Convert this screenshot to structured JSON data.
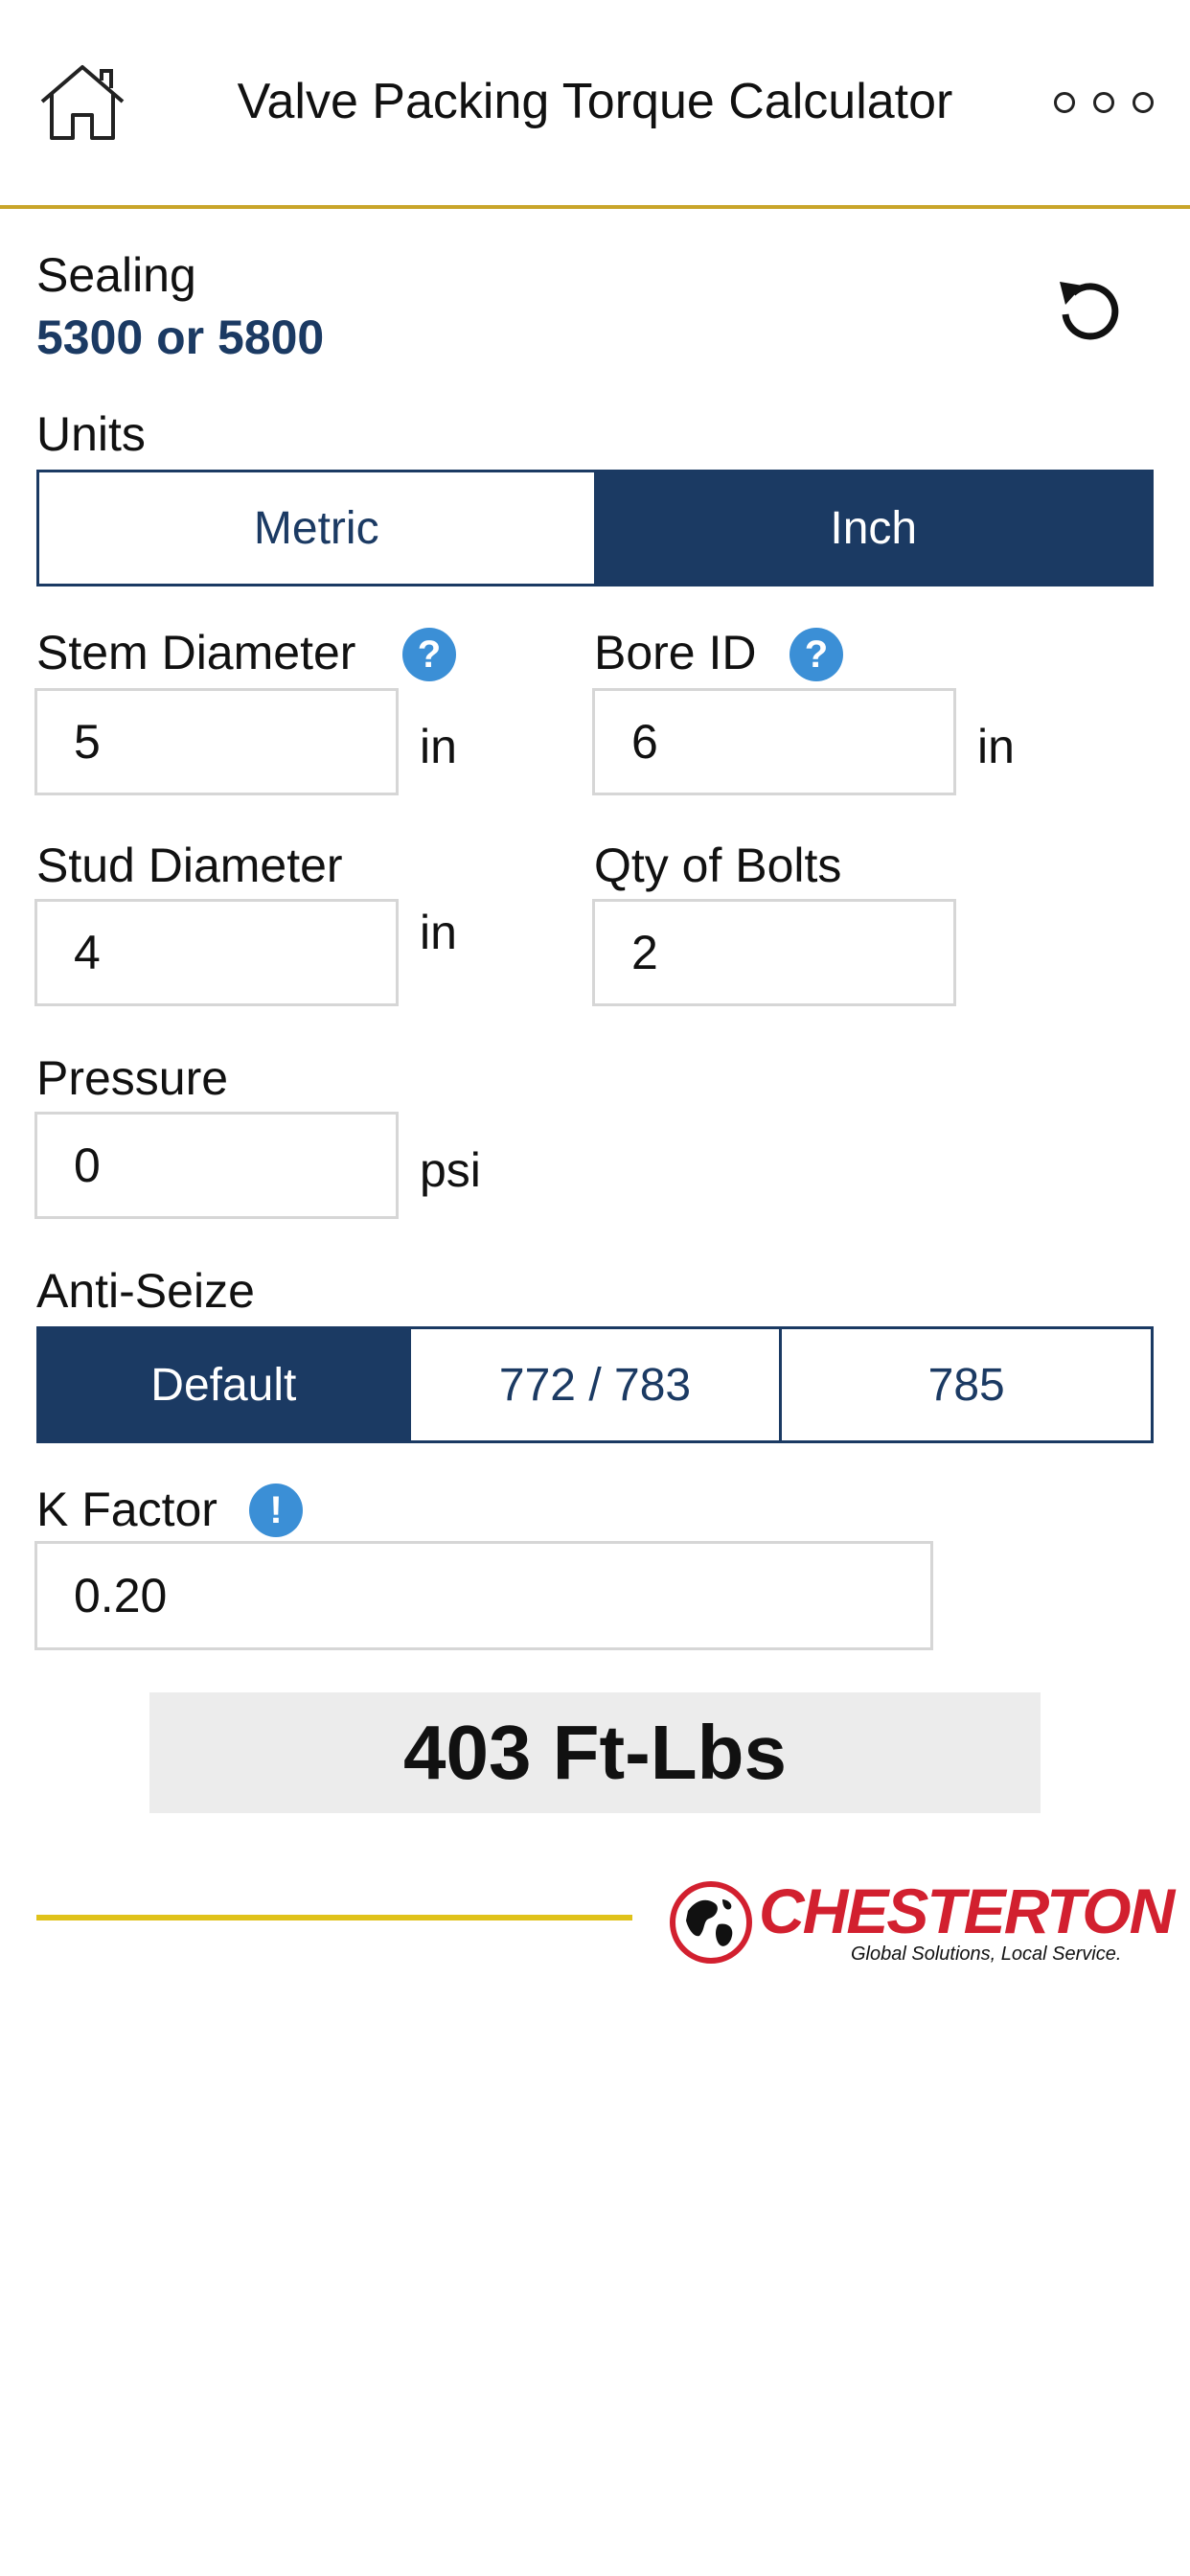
{
  "header": {
    "title": "Valve Packing Torque Calculator",
    "home_icon": "home-icon",
    "more_icon": "more-options-icon"
  },
  "sealing": {
    "label": "Sealing",
    "value": "5300 or 5800",
    "reset_icon": "reset-icon"
  },
  "units": {
    "label": "Units",
    "options": [
      "Metric",
      "Inch"
    ],
    "selected": "Inch"
  },
  "stem_diameter": {
    "label": "Stem Diameter",
    "value": "5",
    "unit": "in",
    "help_icon": "?"
  },
  "bore_id": {
    "label": "Bore ID",
    "value": "6",
    "unit": "in",
    "help_icon": "?"
  },
  "stud_diameter": {
    "label": "Stud Diameter",
    "value": "4",
    "unit": "in"
  },
  "qty_bolts": {
    "label": "Qty of Bolts",
    "value": "2"
  },
  "pressure": {
    "label": "Pressure",
    "value": "0",
    "unit": "psi"
  },
  "anti_seize": {
    "label": "Anti-Seize",
    "options": [
      "Default",
      "772 / 783",
      "785"
    ],
    "selected": "Default"
  },
  "k_factor": {
    "label": "K Factor",
    "value": "0.20",
    "info_icon": "!"
  },
  "result": {
    "text": "403 Ft-Lbs"
  },
  "footer": {
    "brand": "CHESTERTON",
    "tagline": "Global Solutions, Local Service.",
    "colors": {
      "brand_red": "#d2202f",
      "accent_yellow": "#e0c21a",
      "navy": "#1b3a63",
      "help_blue": "#3b8fd6"
    }
  }
}
